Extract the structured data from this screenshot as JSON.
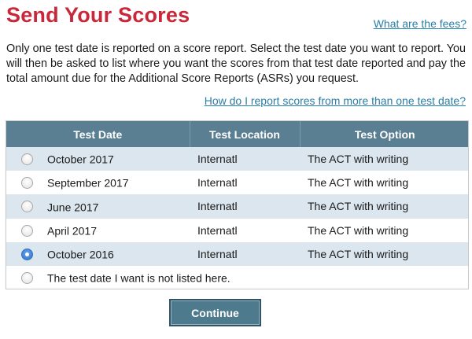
{
  "page": {
    "title": "Send Your Scores",
    "fees_link": "What are the fees?",
    "intro": "Only one test date is reported on a score report. Select the test date you want to report. You will then be asked to list where you want the scores from that test date reported and pay the total amount due for the Additional Score Reports (ASRs) you request.",
    "multi_date_link": "How do I report scores from more than one test date?"
  },
  "table": {
    "headers": [
      "Test Date",
      "Test Location",
      "Test Option"
    ],
    "rows": [
      {
        "date": "October 2017",
        "location": "Internatl",
        "option": "The ACT with writing",
        "selected": false
      },
      {
        "date": "September 2017",
        "location": "Internatl",
        "option": "The ACT with writing",
        "selected": false
      },
      {
        "date": "June 2017",
        "location": "Internatl",
        "option": "The ACT with writing",
        "selected": false
      },
      {
        "date": "April 2017",
        "location": "Internatl",
        "option": "The ACT with writing",
        "selected": false
      },
      {
        "date": "October 2016",
        "location": "Internatl",
        "option": "The ACT with writing",
        "selected": true
      },
      {
        "date": "The test date I want is not listed here.",
        "location": "",
        "option": "",
        "selected": false
      }
    ]
  },
  "buttons": {
    "continue": "Continue"
  },
  "colors": {
    "title": "#c8283a",
    "link": "#2a7fa6",
    "header_bg": "#5a7f93",
    "row_alt_bg": "#dce6ee",
    "button_bg": "#4d7a8c"
  }
}
